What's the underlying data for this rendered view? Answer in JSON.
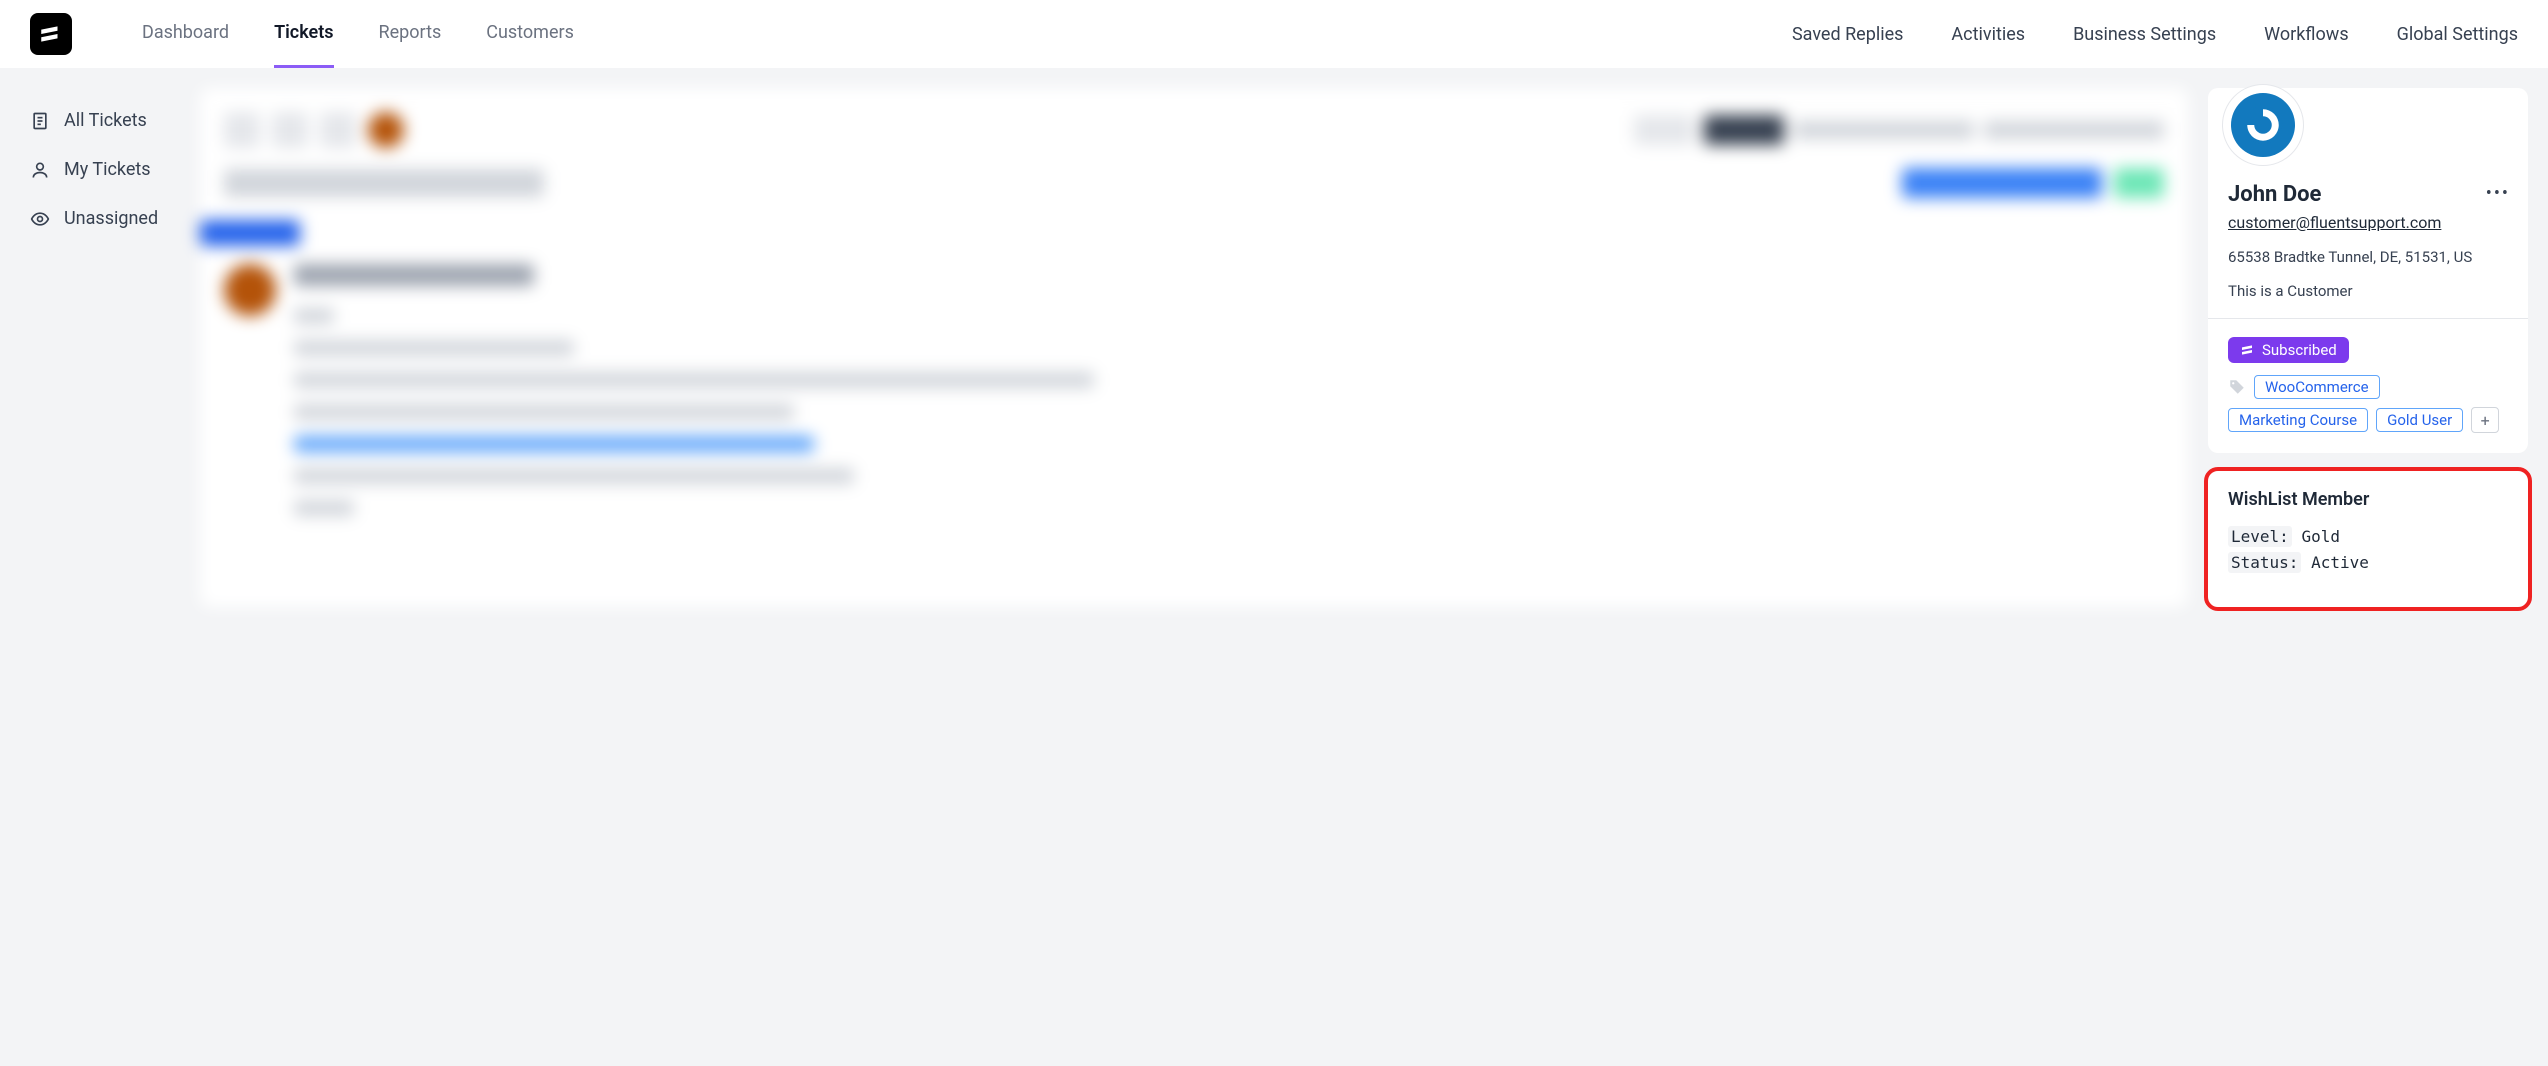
{
  "nav": {
    "main": [
      "Dashboard",
      "Tickets",
      "Reports",
      "Customers"
    ],
    "activeIndex": 1,
    "right": [
      "Saved Replies",
      "Activities",
      "Business Settings",
      "Workflows",
      "Global Settings"
    ]
  },
  "sidebar": {
    "items": [
      {
        "label": "All Tickets",
        "icon": "file"
      },
      {
        "label": "My Tickets",
        "icon": "user"
      },
      {
        "label": "Unassigned",
        "icon": "eye"
      }
    ]
  },
  "customer": {
    "name": "John Doe",
    "email": "customer@fluentsupport.com",
    "address": "65538 Bradtke Tunnel, DE, 51531, US",
    "note": "This is a Customer",
    "subscribed_label": "Subscribed",
    "tags": [
      "WooCommerce",
      "Marketing Course",
      "Gold User"
    ]
  },
  "wishlist": {
    "title": "WishList Member",
    "level_key": "Level:",
    "level_value": "Gold",
    "status_key": "Status:",
    "status_value": "Active"
  }
}
